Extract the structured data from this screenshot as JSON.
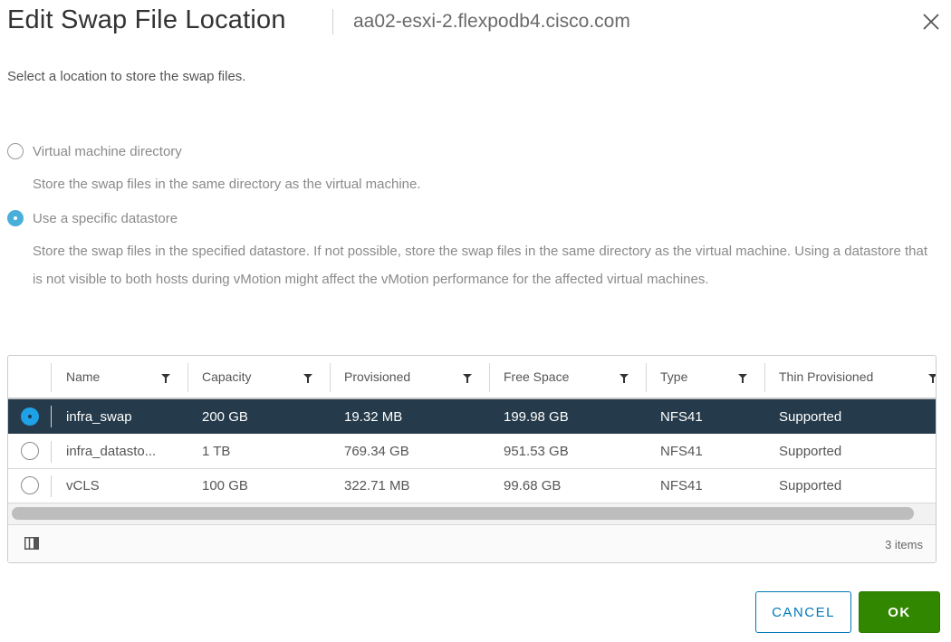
{
  "dialog": {
    "title": "Edit Swap File Location",
    "host": "aa02-esxi-2.flexpodb4.cisco.com",
    "intro": "Select a location to store the swap files."
  },
  "options": [
    {
      "label": "Virtual machine directory",
      "description": "Store the swap files in the same directory as the virtual machine.",
      "selected": false
    },
    {
      "label": "Use a specific datastore",
      "description": "Store the swap files in the specified datastore. If not possible, store the swap files in the same directory as the virtual machine. Using a datastore that is not visible to both hosts during vMotion might affect the vMotion performance for the affected virtual machines.",
      "selected": true
    }
  ],
  "table": {
    "columns": [
      "Name",
      "Capacity",
      "Provisioned",
      "Free Space",
      "Type",
      "Thin Provisioned"
    ],
    "rows": [
      {
        "selected": true,
        "name": "infra_swap",
        "capacity": "200 GB",
        "provisioned": "19.32 MB",
        "free": "199.98 GB",
        "type": "NFS41",
        "thin": "Supported"
      },
      {
        "selected": false,
        "name": "infra_datasto...",
        "capacity": "1 TB",
        "provisioned": "769.34 GB",
        "free": "951.53 GB",
        "type": "NFS41",
        "thin": "Supported"
      },
      {
        "selected": false,
        "name": "vCLS",
        "capacity": "100 GB",
        "provisioned": "322.71 MB",
        "free": "99.68 GB",
        "type": "NFS41",
        "thin": "Supported"
      }
    ],
    "item_count": "3 items"
  },
  "buttons": {
    "cancel": "CANCEL",
    "ok": "OK"
  },
  "colors": {
    "selected_row": "#253a4a",
    "radio_accent": "#49afd9",
    "primary_button": "#318700",
    "secondary_button": "#0079b8"
  }
}
